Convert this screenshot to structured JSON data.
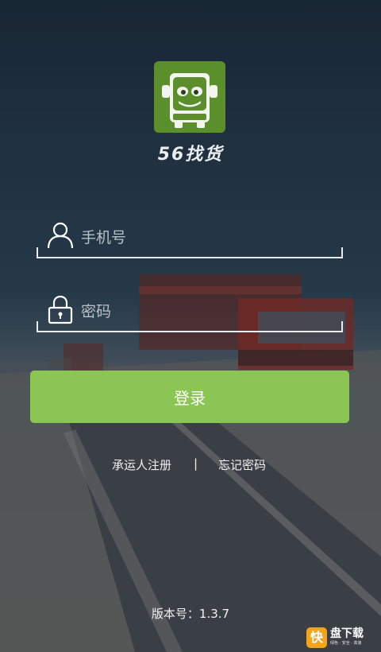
{
  "app": {
    "name": "56找货"
  },
  "login": {
    "phone_placeholder": "手机号",
    "password_placeholder": "密码",
    "login_label": "登录"
  },
  "links": {
    "register_label": "承运人注册",
    "separator": "|",
    "forgot_label": "忘记密码"
  },
  "footer": {
    "version": "版本号：1.3.7"
  },
  "watermark": {
    "badge": "快",
    "title": "盘下载",
    "subtitle": "绿色 · 安全 · 高速"
  },
  "icons": {
    "app": "truck-face-icon",
    "phone": "user-icon",
    "password": "lock-icon"
  },
  "colors": {
    "accent": "#8bc654",
    "icon_bg": "#5a8f2c",
    "text": "#ffffff",
    "watermark": "#f2a51a"
  }
}
